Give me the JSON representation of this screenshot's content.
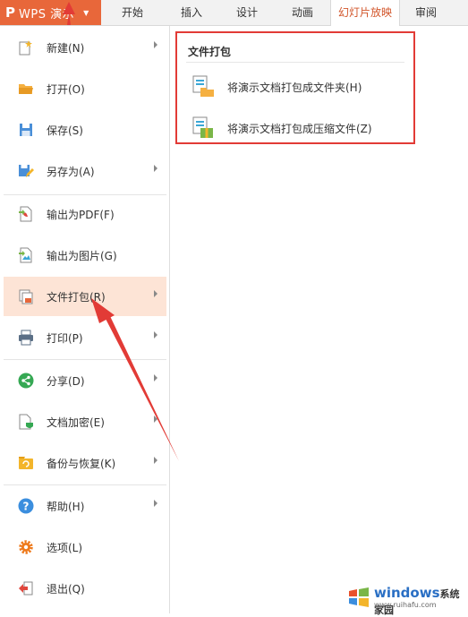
{
  "app": {
    "logo_glyph": "P",
    "title": "WPS 演示",
    "caret": "▼"
  },
  "tabs": [
    {
      "label": "开始",
      "active": false
    },
    {
      "label": "插入",
      "active": false
    },
    {
      "label": "设计",
      "active": false
    },
    {
      "label": "动画",
      "active": false
    },
    {
      "label": "幻灯片放映",
      "active": true
    },
    {
      "label": "审阅",
      "active": false
    }
  ],
  "menu": {
    "items": [
      {
        "label": "新建(N)",
        "icon": "new-file-icon",
        "has_submenu": true
      },
      {
        "label": "打开(O)",
        "icon": "open-folder-icon",
        "has_submenu": false
      },
      {
        "label": "保存(S)",
        "icon": "save-icon",
        "has_submenu": false
      },
      {
        "label": "另存为(A)",
        "icon": "save-as-icon",
        "has_submenu": true
      },
      {
        "label": "输出为PDF(F)",
        "icon": "pdf-export-icon",
        "has_submenu": false
      },
      {
        "label": "输出为图片(G)",
        "icon": "image-export-icon",
        "has_submenu": false
      },
      {
        "label": "文件打包(R)",
        "icon": "package-icon",
        "has_submenu": true,
        "highlighted": true
      },
      {
        "label": "打印(P)",
        "icon": "printer-icon",
        "has_submenu": true
      },
      {
        "label": "分享(D)",
        "icon": "share-icon",
        "has_submenu": true
      },
      {
        "label": "文档加密(E)",
        "icon": "encrypt-icon",
        "has_submenu": true
      },
      {
        "label": "备份与恢复(K)",
        "icon": "backup-icon",
        "has_submenu": true
      },
      {
        "label": "帮助(H)",
        "icon": "help-icon",
        "has_submenu": true
      },
      {
        "label": "选项(L)",
        "icon": "options-gear-icon",
        "has_submenu": false
      },
      {
        "label": "退出(Q)",
        "icon": "exit-icon",
        "has_submenu": false
      }
    ]
  },
  "panel": {
    "title": "文件打包",
    "items": [
      {
        "label": "将演示文档打包成文件夹(H)",
        "icon": "package-folder-icon"
      },
      {
        "label": "将演示文档打包成压缩文件(Z)",
        "icon": "package-zip-icon"
      }
    ]
  },
  "watermark": {
    "title": "windows",
    "suffix": "系统家园",
    "url": "www.ruihafu.com"
  },
  "colors": {
    "accent": "#e8673a",
    "highlight_bg": "#fde4d6",
    "annotation_red": "#e23b36",
    "active_tab_text": "#d2562b"
  }
}
